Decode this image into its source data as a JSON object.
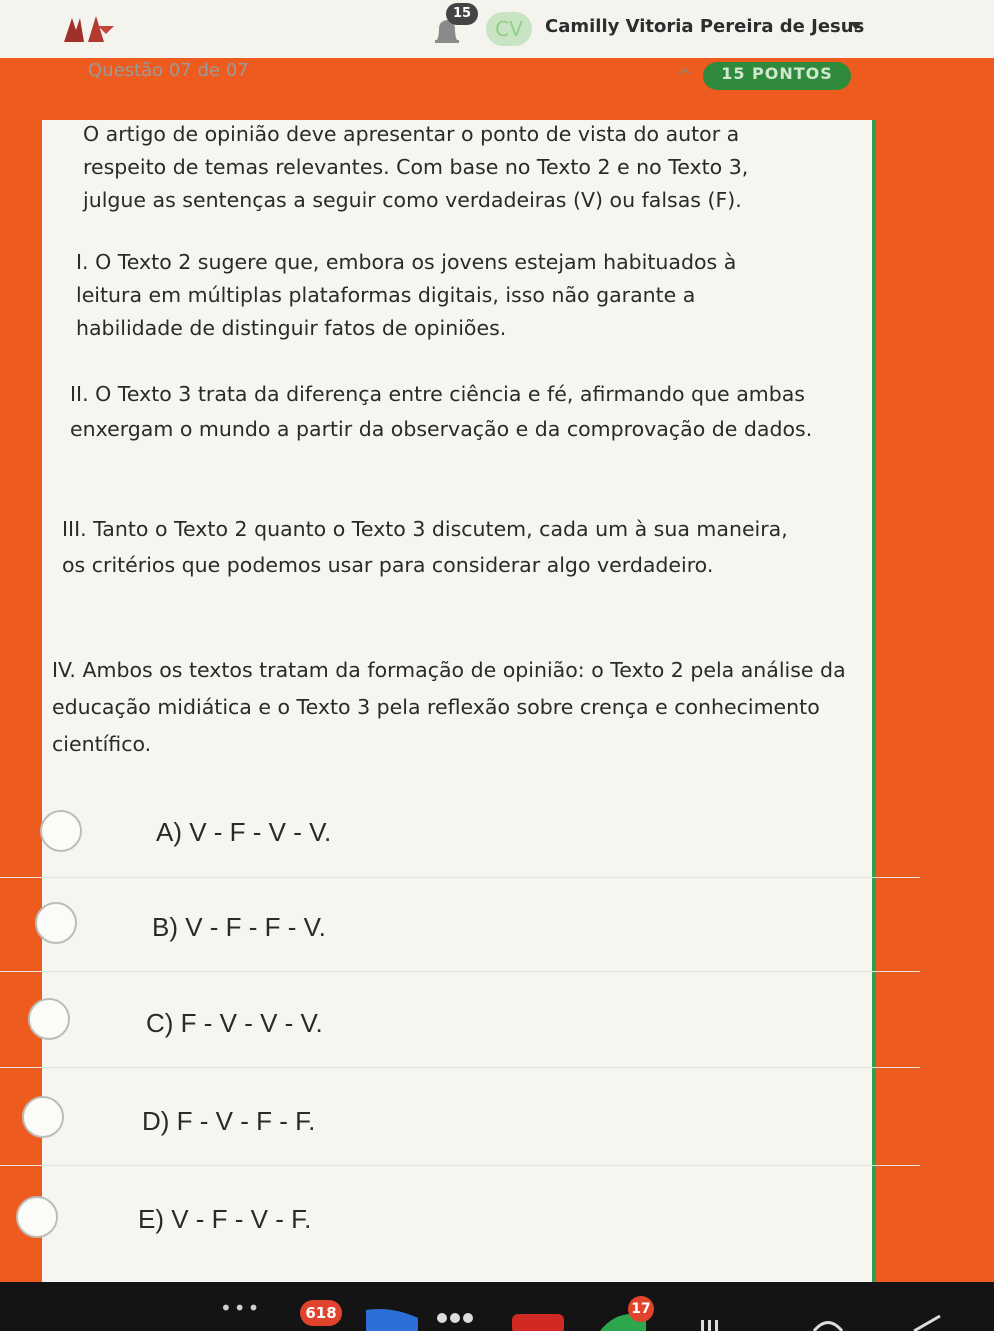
{
  "header": {
    "notification_count": "15",
    "avatar_initials": "CV",
    "user_name": "Camilly Vitoria Pereira de Jesus"
  },
  "question": {
    "counter": "Questão 07 de 07",
    "points": "15 PONTOS",
    "intro": "O artigo de opinião deve apresentar o ponto de vista do autor a respeito de temas relevantes. Com base no Texto 2 e no Texto 3, julgue as sentenças a seguir como verdadeiras (V) ou falsas (F).",
    "statements": [
      "I. O Texto 2 sugere que, embora os jovens estejam habituados à leitura em múltiplas plataformas digitais, isso não garante a habilidade de distinguir fatos de opiniões.",
      "II. O Texto 3 trata da diferença entre ciência e fé, afirmando que ambas enxergam o mundo a partir da observação e da comprovação de dados.",
      "III. Tanto o Texto 2 quanto o Texto 3 discutem, cada um à sua maneira, os critérios que podemos usar para considerar algo verdadeiro.",
      "IV. Ambos os textos tratam da formação de opinião: o Texto 2 pela análise da educação midiática e o Texto 3 pela reflexão sobre crença e conhecimento científico."
    ],
    "options": [
      {
        "label": "A) V - F - V - V."
      },
      {
        "label": "B) V - F - F - V."
      },
      {
        "label": "C) F - V - V - V."
      },
      {
        "label": "D) F - V - F - F."
      },
      {
        "label": "E) V - F - V - F."
      }
    ]
  },
  "taskbar": {
    "dots": "•••",
    "badge_a": "618",
    "badge_b": "17"
  },
  "colors": {
    "frame_orange": "#ee5b1e",
    "accent_green": "#2e9e4f",
    "badge_red": "#e0442c"
  }
}
